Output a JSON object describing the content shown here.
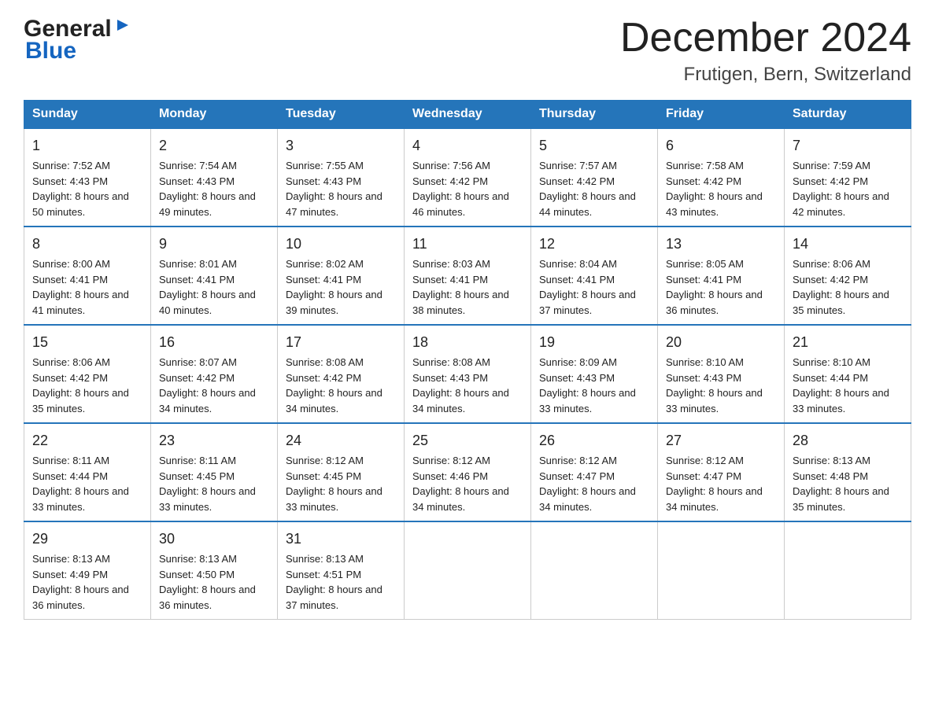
{
  "header": {
    "logo_general": "General",
    "logo_blue": "Blue",
    "month_title": "December 2024",
    "location": "Frutigen, Bern, Switzerland"
  },
  "days_of_week": [
    "Sunday",
    "Monday",
    "Tuesday",
    "Wednesday",
    "Thursday",
    "Friday",
    "Saturday"
  ],
  "weeks": [
    [
      {
        "day": "1",
        "sunrise": "7:52 AM",
        "sunset": "4:43 PM",
        "daylight": "8 hours and 50 minutes."
      },
      {
        "day": "2",
        "sunrise": "7:54 AM",
        "sunset": "4:43 PM",
        "daylight": "8 hours and 49 minutes."
      },
      {
        "day": "3",
        "sunrise": "7:55 AM",
        "sunset": "4:43 PM",
        "daylight": "8 hours and 47 minutes."
      },
      {
        "day": "4",
        "sunrise": "7:56 AM",
        "sunset": "4:42 PM",
        "daylight": "8 hours and 46 minutes."
      },
      {
        "day": "5",
        "sunrise": "7:57 AM",
        "sunset": "4:42 PM",
        "daylight": "8 hours and 44 minutes."
      },
      {
        "day": "6",
        "sunrise": "7:58 AM",
        "sunset": "4:42 PM",
        "daylight": "8 hours and 43 minutes."
      },
      {
        "day": "7",
        "sunrise": "7:59 AM",
        "sunset": "4:42 PM",
        "daylight": "8 hours and 42 minutes."
      }
    ],
    [
      {
        "day": "8",
        "sunrise": "8:00 AM",
        "sunset": "4:41 PM",
        "daylight": "8 hours and 41 minutes."
      },
      {
        "day": "9",
        "sunrise": "8:01 AM",
        "sunset": "4:41 PM",
        "daylight": "8 hours and 40 minutes."
      },
      {
        "day": "10",
        "sunrise": "8:02 AM",
        "sunset": "4:41 PM",
        "daylight": "8 hours and 39 minutes."
      },
      {
        "day": "11",
        "sunrise": "8:03 AM",
        "sunset": "4:41 PM",
        "daylight": "8 hours and 38 minutes."
      },
      {
        "day": "12",
        "sunrise": "8:04 AM",
        "sunset": "4:41 PM",
        "daylight": "8 hours and 37 minutes."
      },
      {
        "day": "13",
        "sunrise": "8:05 AM",
        "sunset": "4:41 PM",
        "daylight": "8 hours and 36 minutes."
      },
      {
        "day": "14",
        "sunrise": "8:06 AM",
        "sunset": "4:42 PM",
        "daylight": "8 hours and 35 minutes."
      }
    ],
    [
      {
        "day": "15",
        "sunrise": "8:06 AM",
        "sunset": "4:42 PM",
        "daylight": "8 hours and 35 minutes."
      },
      {
        "day": "16",
        "sunrise": "8:07 AM",
        "sunset": "4:42 PM",
        "daylight": "8 hours and 34 minutes."
      },
      {
        "day": "17",
        "sunrise": "8:08 AM",
        "sunset": "4:42 PM",
        "daylight": "8 hours and 34 minutes."
      },
      {
        "day": "18",
        "sunrise": "8:08 AM",
        "sunset": "4:43 PM",
        "daylight": "8 hours and 34 minutes."
      },
      {
        "day": "19",
        "sunrise": "8:09 AM",
        "sunset": "4:43 PM",
        "daylight": "8 hours and 33 minutes."
      },
      {
        "day": "20",
        "sunrise": "8:10 AM",
        "sunset": "4:43 PM",
        "daylight": "8 hours and 33 minutes."
      },
      {
        "day": "21",
        "sunrise": "8:10 AM",
        "sunset": "4:44 PM",
        "daylight": "8 hours and 33 minutes."
      }
    ],
    [
      {
        "day": "22",
        "sunrise": "8:11 AM",
        "sunset": "4:44 PM",
        "daylight": "8 hours and 33 minutes."
      },
      {
        "day": "23",
        "sunrise": "8:11 AM",
        "sunset": "4:45 PM",
        "daylight": "8 hours and 33 minutes."
      },
      {
        "day": "24",
        "sunrise": "8:12 AM",
        "sunset": "4:45 PM",
        "daylight": "8 hours and 33 minutes."
      },
      {
        "day": "25",
        "sunrise": "8:12 AM",
        "sunset": "4:46 PM",
        "daylight": "8 hours and 34 minutes."
      },
      {
        "day": "26",
        "sunrise": "8:12 AM",
        "sunset": "4:47 PM",
        "daylight": "8 hours and 34 minutes."
      },
      {
        "day": "27",
        "sunrise": "8:12 AM",
        "sunset": "4:47 PM",
        "daylight": "8 hours and 34 minutes."
      },
      {
        "day": "28",
        "sunrise": "8:13 AM",
        "sunset": "4:48 PM",
        "daylight": "8 hours and 35 minutes."
      }
    ],
    [
      {
        "day": "29",
        "sunrise": "8:13 AM",
        "sunset": "4:49 PM",
        "daylight": "8 hours and 36 minutes."
      },
      {
        "day": "30",
        "sunrise": "8:13 AM",
        "sunset": "4:50 PM",
        "daylight": "8 hours and 36 minutes."
      },
      {
        "day": "31",
        "sunrise": "8:13 AM",
        "sunset": "4:51 PM",
        "daylight": "8 hours and 37 minutes."
      },
      null,
      null,
      null,
      null
    ]
  ],
  "labels": {
    "sunrise_prefix": "Sunrise: ",
    "sunset_prefix": "Sunset: ",
    "daylight_prefix": "Daylight: "
  }
}
